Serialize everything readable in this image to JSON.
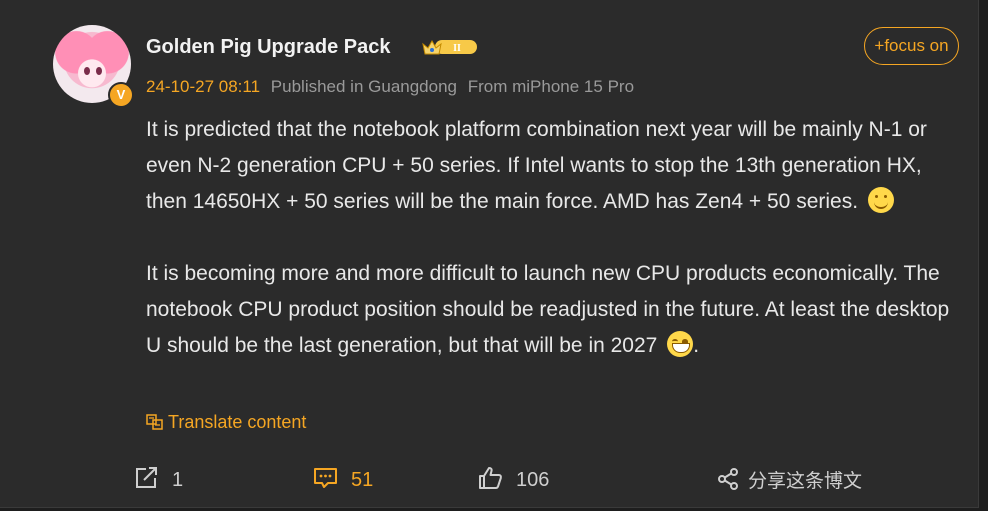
{
  "post": {
    "author": "Golden Pig Upgrade Pack",
    "vip_level": "II",
    "verified_badge": "V",
    "timestamp": "24-10-27 08:11",
    "location": "Published in Guangdong",
    "source": "From miPhone 15 Pro",
    "follow_label": "+focus on",
    "paragraph1": "It is predicted that the notebook platform combination next year will be mainly N-1 or even N-2 generation CPU + 50 series. If Intel wants to stop the 13th generation HX, then 14650HX + 50 series will be the main force. AMD has Zen4 + 50 series.",
    "paragraph2": "It is becoming more and more difficult to launch new CPU products economically. The notebook CPU product position should be readjusted in the future. At least the desktop U should be the last generation, but that will be in 2027",
    "paragraph2_end": ".",
    "translate_label": "Translate content"
  },
  "actions": {
    "repost_count": "1",
    "comment_count": "51",
    "like_count": "106",
    "share_label": "分享这条博文"
  },
  "colors": {
    "accent": "#f5a623",
    "background": "#2b2b2b",
    "text": "#e8e8e8",
    "muted": "#9a9a9a"
  },
  "icons": [
    "avatar",
    "verified-badge-icon",
    "vip-crown-icon",
    "smile-emoji-icon",
    "laugh-emoji-icon",
    "translate-icon",
    "repost-icon",
    "comment-icon",
    "like-icon",
    "share-icon"
  ]
}
